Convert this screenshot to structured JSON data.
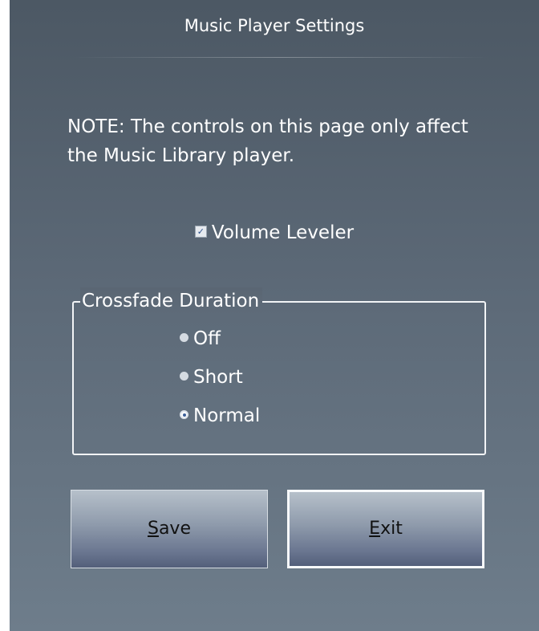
{
  "window": {
    "title": "Music Player Settings"
  },
  "note": {
    "text": "NOTE: The controls on this page only affect the Music Library player."
  },
  "volume_leveler": {
    "label": "Volume Leveler",
    "checked": true
  },
  "crossfade": {
    "legend": "Crossfade Duration",
    "options": [
      {
        "label": "Off",
        "selected": false
      },
      {
        "label": "Short",
        "selected": false
      },
      {
        "label": "Normal",
        "selected": true
      }
    ]
  },
  "buttons": {
    "save": {
      "accelerator": "S",
      "rest": "ave"
    },
    "exit": {
      "accelerator": "E",
      "rest": "xit"
    }
  },
  "colors": {
    "accent": "#3b5f99"
  }
}
